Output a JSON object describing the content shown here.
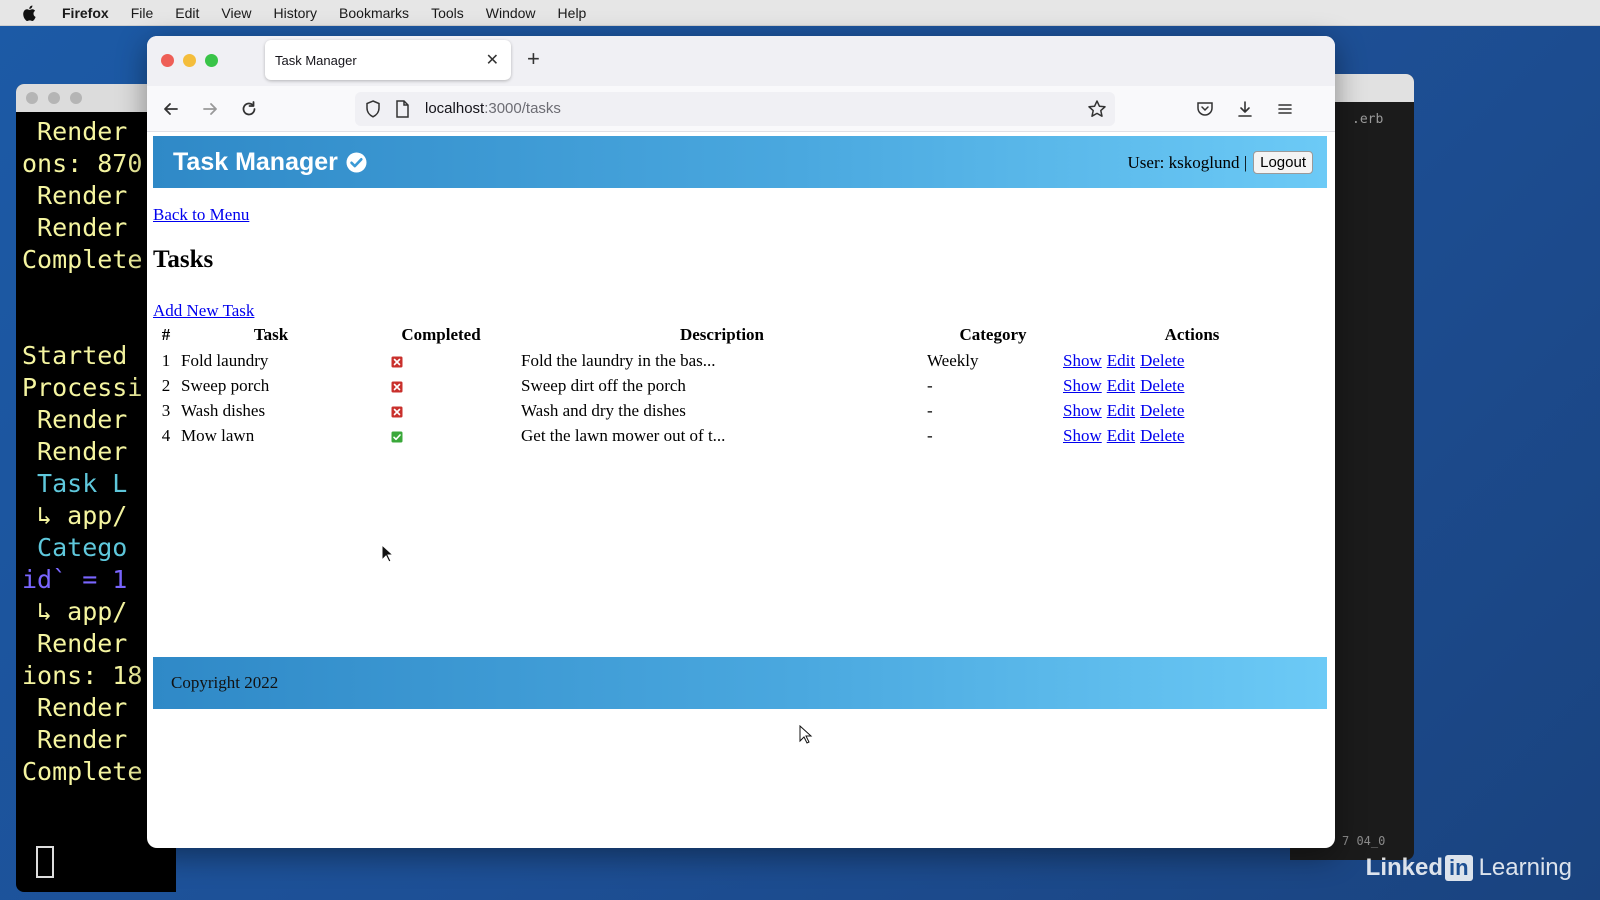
{
  "menubar": {
    "app": "Firefox",
    "items": [
      "File",
      "Edit",
      "View",
      "History",
      "Bookmarks",
      "Tools",
      "Window",
      "Help"
    ]
  },
  "terminal": {
    "lines": [
      {
        "text": " Render",
        "color": "#f5f5a0"
      },
      {
        "text": "ons: 870",
        "color": "#f5f5a0"
      },
      {
        "text": " Render",
        "color": "#f5f5a0"
      },
      {
        "text": " Render",
        "color": "#f5f5a0"
      },
      {
        "text": "Complete",
        "color": "#f5f5a0"
      },
      {
        "text": "",
        "color": "#f5f5a0"
      },
      {
        "text": "",
        "color": "#f5f5a0"
      },
      {
        "text": "Started ",
        "color": "#f5f5a0"
      },
      {
        "text": "Processi",
        "color": "#f5f5a0"
      },
      {
        "text": " Render",
        "color": "#f5f5a0"
      },
      {
        "text": " Render",
        "color": "#f5f5a0"
      },
      {
        "text": " Task L",
        "color": "#5fc8dc"
      },
      {
        "text": " ↳ app/",
        "color": "#f5f5a0"
      },
      {
        "text": " Catego",
        "color": "#5fc8dc"
      },
      {
        "text": "id` = 1 ",
        "color": "#7a66ff"
      },
      {
        "text": " ↳ app/",
        "color": "#f5f5a0"
      },
      {
        "text": " Render",
        "color": "#f5f5a0"
      },
      {
        "text": "ions: 18",
        "color": "#f5f5a0"
      },
      {
        "text": " Render",
        "color": "#f5f5a0"
      },
      {
        "text": " Render",
        "color": "#f5f5a0"
      },
      {
        "text": "Complete",
        "color": "#f5f5a0"
      }
    ]
  },
  "editor": {
    "tab_text": ".erb",
    "footer_text": "7 04_0"
  },
  "browser": {
    "tab_title": "Task Manager",
    "url_host": "localhost",
    "url_path": ":3000/tasks"
  },
  "app": {
    "title": "Task Manager",
    "user_label": "User: kskoglund |",
    "logout_label": "Logout",
    "back_link": "Back to Menu",
    "heading": "Tasks",
    "add_link": "Add New Task",
    "footer": "Copyright 2022",
    "columns": [
      "#",
      "Task",
      "Completed",
      "Description",
      "Category",
      "Actions"
    ],
    "tasks": [
      {
        "num": "1",
        "name": "Fold laundry",
        "completed": false,
        "description": "Fold the laundry in the bas...",
        "category": "Weekly"
      },
      {
        "num": "2",
        "name": "Sweep porch",
        "completed": false,
        "description": "Sweep dirt off the porch",
        "category": "-"
      },
      {
        "num": "3",
        "name": "Wash dishes",
        "completed": false,
        "description": "Wash and dry the dishes",
        "category": "-"
      },
      {
        "num": "4",
        "name": "Mow lawn",
        "completed": true,
        "description": "Get the lawn mower out of t...",
        "category": "-"
      }
    ],
    "action_labels": {
      "show": "Show",
      "edit": "Edit",
      "delete": "Delete"
    }
  },
  "colors": {
    "header_start": "#2f89c7",
    "header_end": "#6ccaf6",
    "link": "#0000ee",
    "status_incomplete": "#c9302c",
    "status_complete": "#3aa83a"
  },
  "watermark": {
    "brand_prefix": "Linked",
    "brand_box": "in",
    "brand_suffix": "Learning"
  }
}
